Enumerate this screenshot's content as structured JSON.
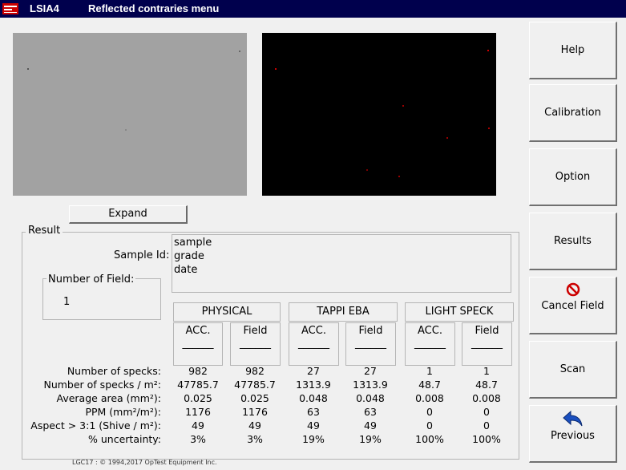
{
  "app": {
    "name": "LSIA4",
    "window_title": "Reflected contraries menu",
    "logo": "optest-logo"
  },
  "expand_label": "Expand",
  "result": {
    "legend": "Result",
    "sample_id_label": "Sample Id:",
    "sample_lines": [
      "sample",
      "grade",
      "date"
    ],
    "field_legend": "Number of Field:",
    "field_value": "1"
  },
  "groups": [
    "PHYSICAL",
    "TAPPI EBA",
    "LIGHT SPECK"
  ],
  "columns": [
    "ACC.",
    "Field",
    "ACC.",
    "Field",
    "ACC.",
    "Field"
  ],
  "underline": "______",
  "rows": [
    {
      "label": "Number of specks:",
      "values": [
        "982",
        "982",
        "27",
        "27",
        "1",
        "1"
      ]
    },
    {
      "label": "Number of specks / m²:",
      "values": [
        "47785.7",
        "47785.7",
        "1313.9",
        "1313.9",
        "48.7",
        "48.7"
      ]
    },
    {
      "label": "Average area (mm²):",
      "values": [
        "0.025",
        "0.025",
        "0.048",
        "0.048",
        "0.008",
        "0.008"
      ]
    },
    {
      "label": "PPM (mm²/m²):",
      "values": [
        "1176",
        "1176",
        "63",
        "63",
        "0",
        "0"
      ]
    },
    {
      "label": "Aspect > 3:1 (Shive / m²):",
      "values": [
        "49",
        "49",
        "49",
        "49",
        "0",
        "0"
      ]
    },
    {
      "label": "% uncertainty:",
      "values": [
        "3%",
        "3%",
        "19%",
        "19%",
        "100%",
        "100%"
      ]
    }
  ],
  "footer": "LGC17 :  © 1994,2017 OpTest Equipment Inc.",
  "side_buttons": {
    "help": "Help",
    "calibration": "Calibration",
    "option": "Option",
    "results": "Results",
    "cancel_field": "Cancel Field",
    "scan": "Scan",
    "previous": "Previous"
  },
  "icons": {
    "cancel": "no-entry-icon",
    "previous": "back-arrow-icon"
  },
  "colors": {
    "titlebar": "#00004d",
    "cancel_icon": "#cc0000",
    "previous_icon": "#1a4fbf"
  }
}
